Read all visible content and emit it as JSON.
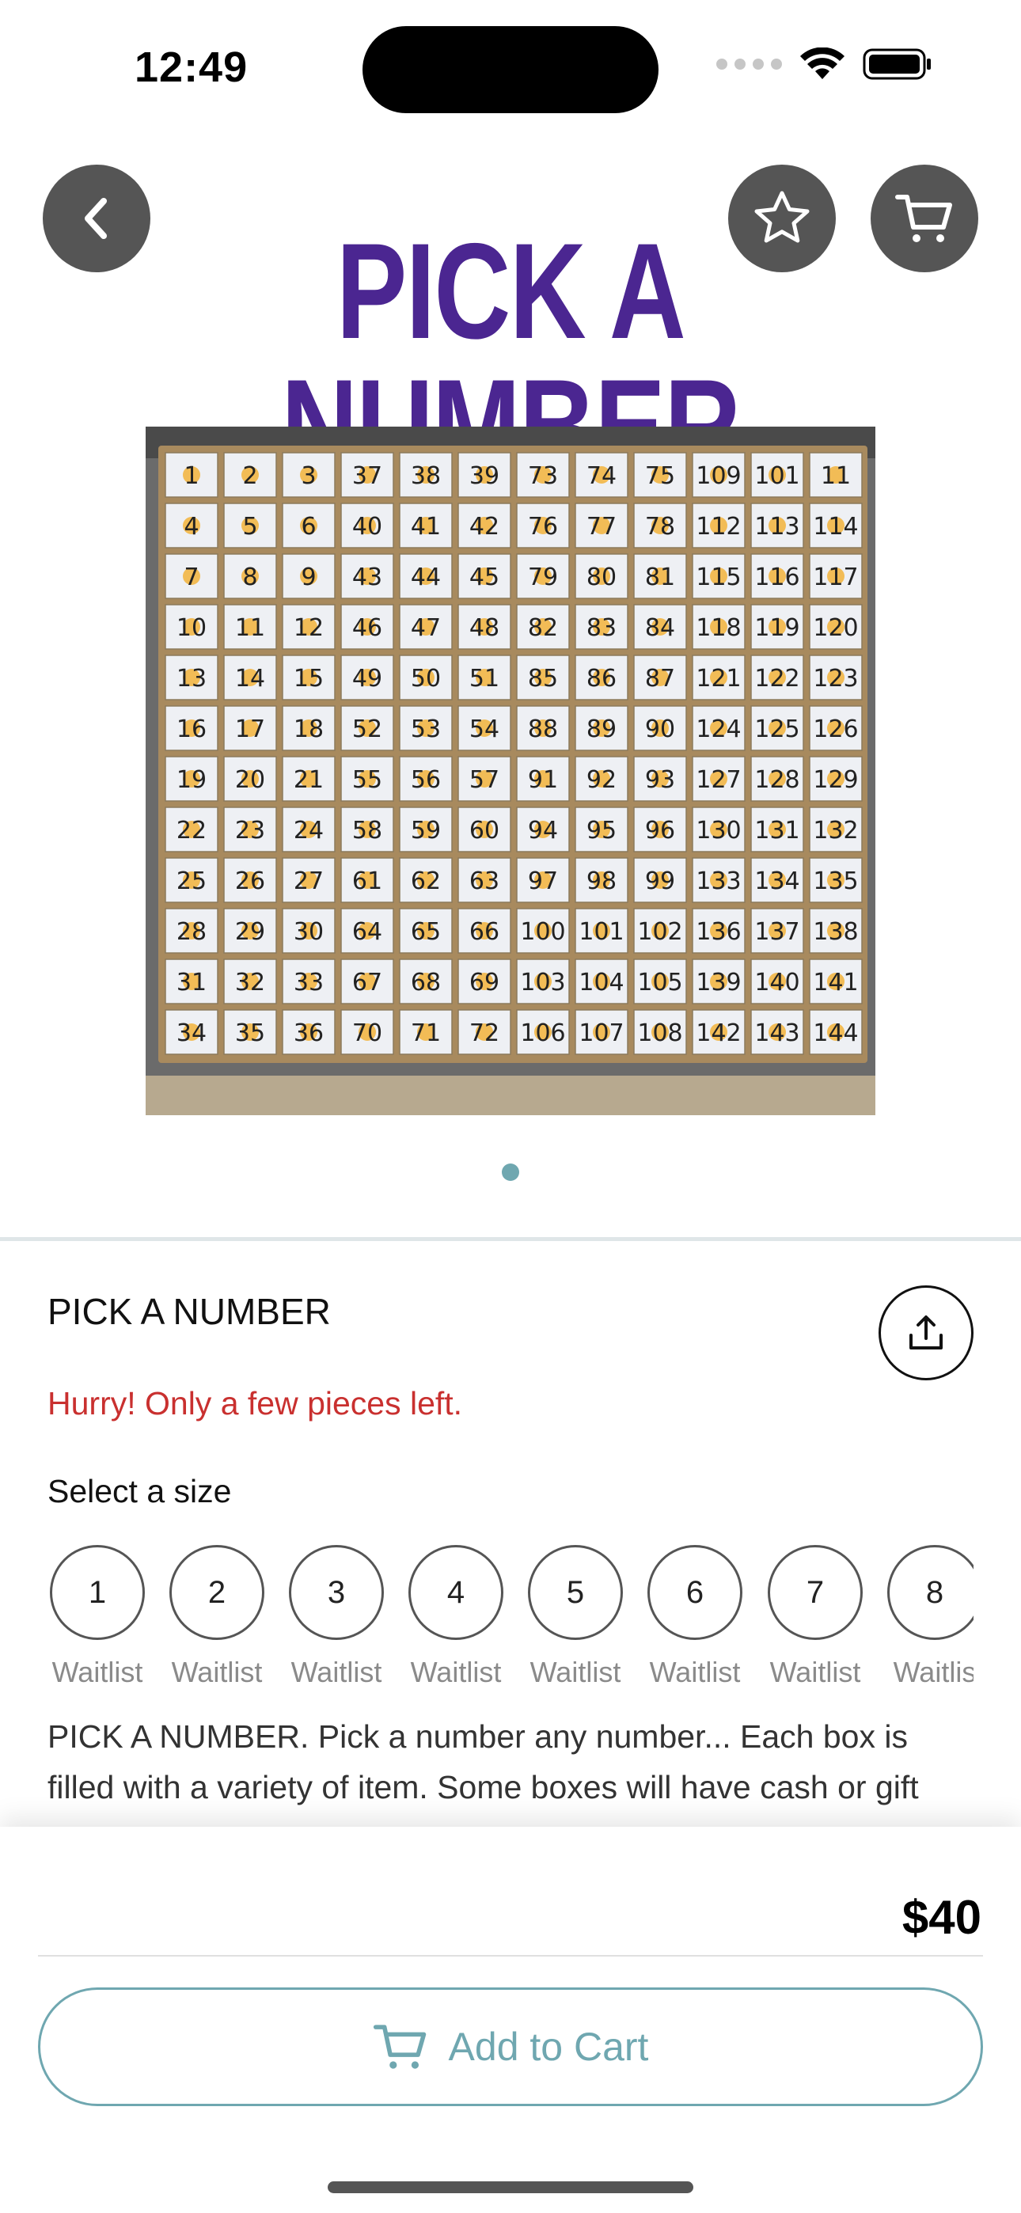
{
  "status_bar": {
    "time": "12:49"
  },
  "hero": {
    "title_text": "PICK A NUMBER",
    "back_icon": "chevron-left-icon",
    "favorite_icon": "star-outline-icon",
    "cart_icon": "cart-icon",
    "title_color": "#4b2691",
    "page_count": 1,
    "active_page": 1
  },
  "product": {
    "name": "PICK A NUMBER",
    "stock_note": "Hurry! Only a few pieces left.",
    "size_label": "Select a size",
    "sizes": [
      {
        "value": "1",
        "status": "Waitlist"
      },
      {
        "value": "2",
        "status": "Waitlist"
      },
      {
        "value": "3",
        "status": "Waitlist"
      },
      {
        "value": "4",
        "status": "Waitlist"
      },
      {
        "value": "5",
        "status": "Waitlist"
      },
      {
        "value": "6",
        "status": "Waitlist"
      },
      {
        "value": "7",
        "status": "Waitlist"
      },
      {
        "value": "8",
        "status": "Waitlis"
      }
    ],
    "description": "PICK A NUMBER. Pick a number any number... Each box is filled with a variety of item. Some boxes will have cash or gift"
  },
  "photo_box_numbers": [
    [
      "1",
      "2",
      "3",
      "37",
      "38",
      "39",
      "73",
      "74",
      "75",
      "109",
      "101",
      "11"
    ],
    [
      "4",
      "5",
      "6",
      "40",
      "41",
      "42",
      "76",
      "77",
      "78",
      "112",
      "113",
      "114"
    ],
    [
      "7",
      "8",
      "9",
      "43",
      "44",
      "45",
      "79",
      "80",
      "81",
      "115",
      "116",
      "117"
    ],
    [
      "10",
      "11",
      "12",
      "46",
      "47",
      "48",
      "82",
      "83",
      "84",
      "118",
      "119",
      "120"
    ],
    [
      "13",
      "14",
      "15",
      "49",
      "50",
      "51",
      "85",
      "86",
      "87",
      "121",
      "122",
      "123"
    ],
    [
      "16",
      "17",
      "18",
      "52",
      "53",
      "54",
      "88",
      "89",
      "90",
      "124",
      "125",
      "126"
    ],
    [
      "19",
      "20",
      "21",
      "55",
      "56",
      "57",
      "91",
      "92",
      "93",
      "127",
      "128",
      "129"
    ],
    [
      "22",
      "23",
      "24",
      "58",
      "59",
      "60",
      "94",
      "95",
      "96",
      "130",
      "131",
      "132"
    ],
    [
      "25",
      "26",
      "27",
      "61",
      "62",
      "63",
      "97",
      "98",
      "99",
      "133",
      "134",
      "135"
    ],
    [
      "28",
      "29",
      "30",
      "64",
      "65",
      "66",
      "100",
      "101",
      "102",
      "136",
      "137",
      "138"
    ],
    [
      "31",
      "32",
      "33",
      "67",
      "68",
      "69",
      "103",
      "104",
      "105",
      "139",
      "140",
      "141"
    ],
    [
      "34",
      "35",
      "36",
      "70",
      "71",
      "72",
      "106",
      "107",
      "108",
      "142",
      "143",
      "144"
    ]
  ],
  "cart_bar": {
    "price": "$40",
    "button_label": "Add to Cart",
    "button_icon": "cart-icon",
    "accent_color": "#6fa7b0"
  }
}
